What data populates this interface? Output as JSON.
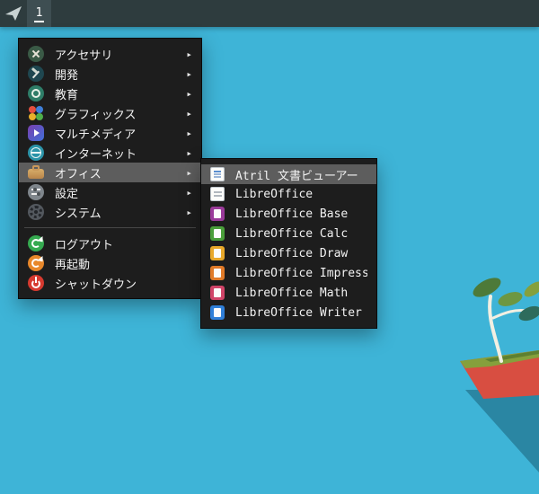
{
  "colors": {
    "desktop_bg": "#3eb4d7",
    "taskbar_bg": "#2e3c3e",
    "workspace_tile_bg": "#3e4e52",
    "menu_bg": "#1d1d1d",
    "menu_highlight": "#5d5d5d",
    "menu_text": "#f2f2f2"
  },
  "taskbar": {
    "launcher_icon": "paper-plane-icon",
    "workspace_label": "1"
  },
  "main_menu": {
    "submenu_arrow": "▸",
    "items": [
      {
        "label": "アクセサリ",
        "icon": "accessories-icon"
      },
      {
        "label": "開発",
        "icon": "development-icon"
      },
      {
        "label": "教育",
        "icon": "education-icon"
      },
      {
        "label": "グラフィックス",
        "icon": "graphics-icon"
      },
      {
        "label": "マルチメディア",
        "icon": "multimedia-icon"
      },
      {
        "label": "インターネット",
        "icon": "internet-icon"
      },
      {
        "label": "オフィス",
        "icon": "office-icon",
        "highlighted": true
      },
      {
        "label": "設定",
        "icon": "settings-icon"
      },
      {
        "label": "システム",
        "icon": "system-icon"
      }
    ],
    "actions": [
      {
        "label": "ログアウト",
        "icon": "logout-icon"
      },
      {
        "label": "再起動",
        "icon": "reboot-icon"
      },
      {
        "label": "シャットダウン",
        "icon": "shutdown-icon"
      }
    ]
  },
  "office_submenu": {
    "items": [
      {
        "label": "Atril 文書ビューアー",
        "icon": "atril-document-viewer-icon",
        "highlighted": true
      },
      {
        "label": "LibreOffice",
        "icon": "libreoffice-icon"
      },
      {
        "label": "LibreOffice Base",
        "icon": "libreoffice-base-icon"
      },
      {
        "label": "LibreOffice Calc",
        "icon": "libreoffice-calc-icon"
      },
      {
        "label": "LibreOffice Draw",
        "icon": "libreoffice-draw-icon"
      },
      {
        "label": "LibreOffice Impress",
        "icon": "libreoffice-impress-icon"
      },
      {
        "label": "LibreOffice Math",
        "icon": "libreoffice-math-icon"
      },
      {
        "label": "LibreOffice Writer",
        "icon": "libreoffice-writer-icon"
      }
    ]
  }
}
